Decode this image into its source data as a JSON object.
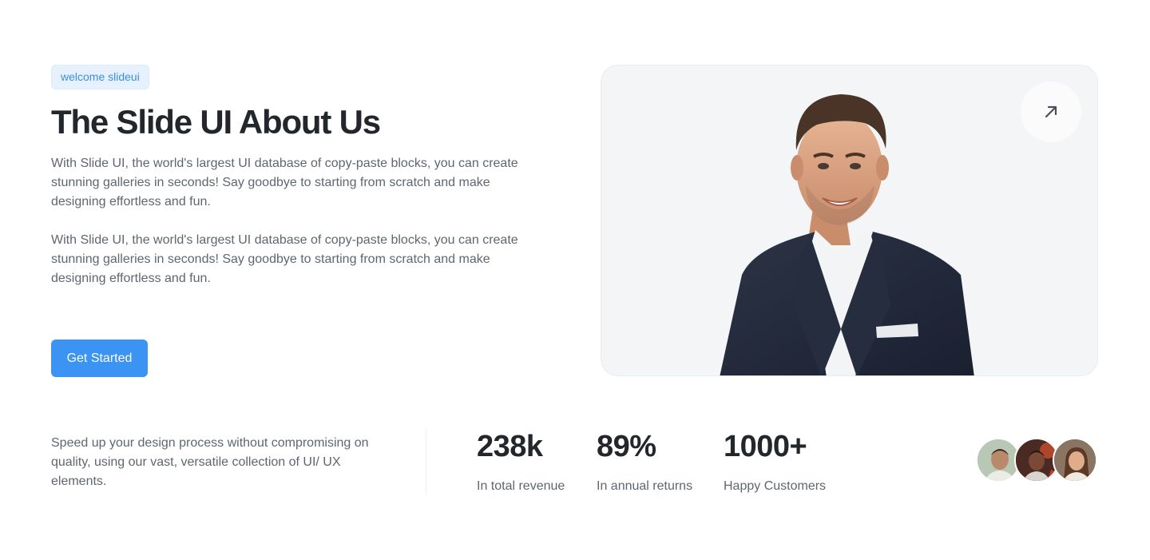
{
  "hero": {
    "badge": "welcome slideui",
    "title": "The Slide UI About Us",
    "paragraphs": [
      "With Slide UI, the world's largest UI database of copy-paste blocks, you can create stunning galleries in seconds! Say goodbye to starting from scratch and make designing effortless and fun.",
      "With Slide UI, the world's largest UI database of copy-paste blocks, you can create stunning galleries in seconds! Say goodbye to starting from scratch and make designing effortless and fun."
    ],
    "cta_label": "Get Started",
    "accent_color": "#3b93f4"
  },
  "media": {
    "photo": "portrait-man-in-suit",
    "action_icon": "arrow-up-right-icon"
  },
  "stats_section": {
    "tagline": "Speed up your design process without compromising on quality, using our vast, versatile collection of UI/ UX elements.",
    "stats": [
      {
        "value": "238k",
        "label": "In total revenue"
      },
      {
        "value": "89%",
        "label": "In annual returns"
      },
      {
        "value": "1000+",
        "label": "Happy Customers"
      }
    ],
    "avatars": [
      "customer-avatar",
      "customer-avatar",
      "customer-avatar"
    ]
  }
}
